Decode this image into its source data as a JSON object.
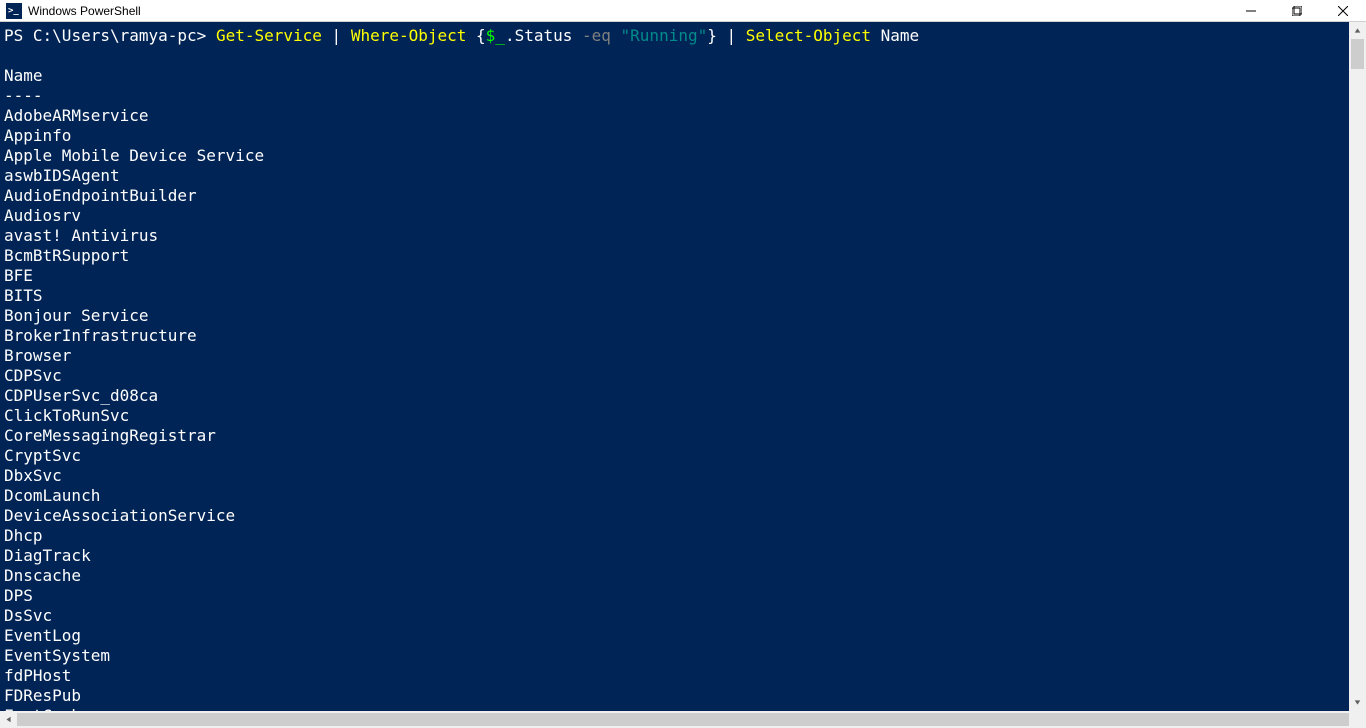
{
  "window": {
    "title": "Windows PowerShell"
  },
  "prompt": {
    "ps": "PS ",
    "path": "C:\\Users\\ramya-pc",
    "gt": "> ",
    "cmd1": "Get-Service",
    "pipe": " | ",
    "cmd2": "Where-Object",
    "lbrace": " {",
    "dollar": "$_",
    "dot": ".Status ",
    "op": "-eq ",
    "str": "\"Running\"",
    "rbrace": "}",
    "cmd3": "Select-Object",
    "arg": " Name"
  },
  "output": {
    "header": "Name",
    "divider": "----",
    "rows": [
      "AdobeARMservice",
      "Appinfo",
      "Apple Mobile Device Service",
      "aswbIDSAgent",
      "AudioEndpointBuilder",
      "Audiosrv",
      "avast! Antivirus",
      "BcmBtRSupport",
      "BFE",
      "BITS",
      "Bonjour Service",
      "BrokerInfrastructure",
      "Browser",
      "CDPSvc",
      "CDPUserSvc_d08ca",
      "ClickToRunSvc",
      "CoreMessagingRegistrar",
      "CryptSvc",
      "DbxSvc",
      "DcomLaunch",
      "DeviceAssociationService",
      "Dhcp",
      "DiagTrack",
      "Dnscache",
      "DPS",
      "DsSvc",
      "EventLog",
      "EventSystem",
      "fdPHost",
      "FDResPub",
      "FontCache"
    ]
  }
}
